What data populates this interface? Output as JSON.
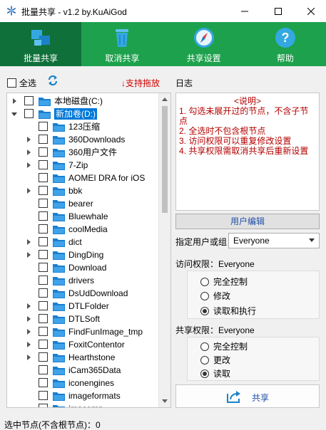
{
  "window": {
    "title": "批量共享 - v1.2 by.KuAiGod"
  },
  "toolbar": {
    "items": [
      {
        "label": "批量共享",
        "icon": "grid-tiles-icon",
        "active": true
      },
      {
        "label": "取消共享",
        "icon": "trash-icon",
        "active": false
      },
      {
        "label": "共享设置",
        "icon": "compass-icon",
        "active": false
      },
      {
        "label": "帮助",
        "icon": "help-icon",
        "active": false
      }
    ]
  },
  "left": {
    "select_all_label": "全选",
    "drag_hint": "↓支持拖放"
  },
  "tree": {
    "nodes": [
      {
        "label": "本地磁盘(C:)",
        "level": 0,
        "expander": "collapsed",
        "checked": false,
        "selected": false
      },
      {
        "label": "新加卷(D:)",
        "level": 0,
        "expander": "expanded",
        "checked": false,
        "selected": true
      },
      {
        "label": "123压缩",
        "level": 1,
        "expander": "none",
        "checked": false,
        "selected": false
      },
      {
        "label": "360Downloads",
        "level": 1,
        "expander": "collapsed",
        "checked": false,
        "selected": false
      },
      {
        "label": "360用户文件",
        "level": 1,
        "expander": "collapsed",
        "checked": false,
        "selected": false
      },
      {
        "label": "7-Zip",
        "level": 1,
        "expander": "collapsed",
        "checked": false,
        "selected": false
      },
      {
        "label": "AOMEI DRA for iOS",
        "level": 1,
        "expander": "none",
        "checked": false,
        "selected": false
      },
      {
        "label": "bbk",
        "level": 1,
        "expander": "collapsed",
        "checked": false,
        "selected": false
      },
      {
        "label": "bearer",
        "level": 1,
        "expander": "none",
        "checked": false,
        "selected": false
      },
      {
        "label": "Bluewhale",
        "level": 1,
        "expander": "none",
        "checked": false,
        "selected": false
      },
      {
        "label": "coolMedia",
        "level": 1,
        "expander": "none",
        "checked": false,
        "selected": false
      },
      {
        "label": "dict",
        "level": 1,
        "expander": "collapsed",
        "checked": false,
        "selected": false
      },
      {
        "label": "DingDing",
        "level": 1,
        "expander": "collapsed",
        "checked": false,
        "selected": false
      },
      {
        "label": "Download",
        "level": 1,
        "expander": "none",
        "checked": false,
        "selected": false
      },
      {
        "label": "drivers",
        "level": 1,
        "expander": "none",
        "checked": false,
        "selected": false
      },
      {
        "label": "DsUdDownload",
        "level": 1,
        "expander": "none",
        "checked": false,
        "selected": false
      },
      {
        "label": "DTLFolder",
        "level": 1,
        "expander": "collapsed",
        "checked": false,
        "selected": false
      },
      {
        "label": "DTLSoft",
        "level": 1,
        "expander": "collapsed",
        "checked": false,
        "selected": false
      },
      {
        "label": "FindFunImage_tmp",
        "level": 1,
        "expander": "collapsed",
        "checked": false,
        "selected": false
      },
      {
        "label": "FoxitContentor",
        "level": 1,
        "expander": "collapsed",
        "checked": false,
        "selected": false
      },
      {
        "label": "Hearthstone",
        "level": 1,
        "expander": "collapsed",
        "checked": false,
        "selected": false
      },
      {
        "label": "iCam365Data",
        "level": 1,
        "expander": "none",
        "checked": false,
        "selected": false
      },
      {
        "label": "iconengines",
        "level": 1,
        "expander": "none",
        "checked": false,
        "selected": false
      },
      {
        "label": "imageformats",
        "level": 1,
        "expander": "none",
        "checked": false,
        "selected": false
      },
      {
        "label": "imacomp",
        "level": 1,
        "expander": "none",
        "checked": false,
        "selected": false
      }
    ]
  },
  "log": {
    "title": "日志",
    "heading": "<说明>",
    "lines": [
      "1. 勾选未展开过的节点，不含子节点",
      "2. 全选时不包含根节点",
      "3. 访问权限可以重复修改设置",
      "4. 共享权限需取消共享后重新设置"
    ]
  },
  "user": {
    "edit_button": "用户编辑",
    "label": "指定用户或组",
    "selected": "Everyone"
  },
  "access": {
    "label": "访问权限：Everyone",
    "options": [
      "完全控制",
      "修改",
      "读取和执行"
    ],
    "selected_index": 2
  },
  "sharing": {
    "label": "共享权限：Everyone",
    "options": [
      "完全控制",
      "更改",
      "读取"
    ],
    "selected_index": 2
  },
  "share_button": "共享",
  "status": "选中节点(不含根节点)：0",
  "colors": {
    "toolbar_bg": "#1ea14d",
    "toolbar_active": "#10703a",
    "hint_red": "#d00000",
    "log_red": "#b40000",
    "link_blue": "#1f4fa8",
    "selection": "#0078d7"
  }
}
